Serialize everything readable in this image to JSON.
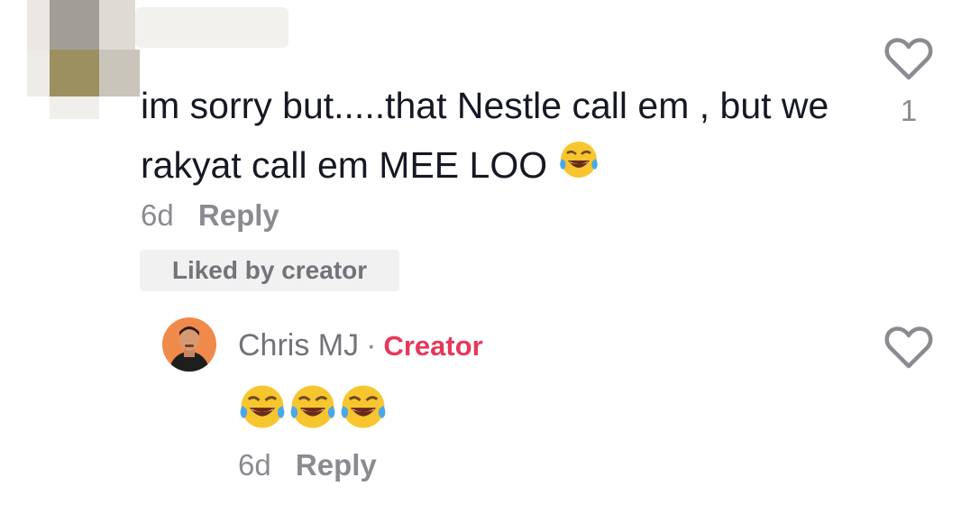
{
  "comment": {
    "text": "im sorry but.....that Nestle call em , but we rakyat call em MEE LOO",
    "emoji": "face-with-tears-of-joy",
    "time": "6d",
    "reply_label": "Reply",
    "liked_badge": "Liked by creator",
    "like_count": "1"
  },
  "reply": {
    "author": "Chris MJ",
    "separator": "·",
    "role": "Creator",
    "emojis": [
      "face-with-tears-of-joy",
      "face-with-tears-of-joy",
      "face-with-tears-of-joy"
    ],
    "time": "6d",
    "reply_label": "Reply"
  },
  "colors": {
    "text": "#161823",
    "muted": "#8a8b91",
    "creator_accent": "#e6385b",
    "badge_bg": "#f1f1f2"
  }
}
